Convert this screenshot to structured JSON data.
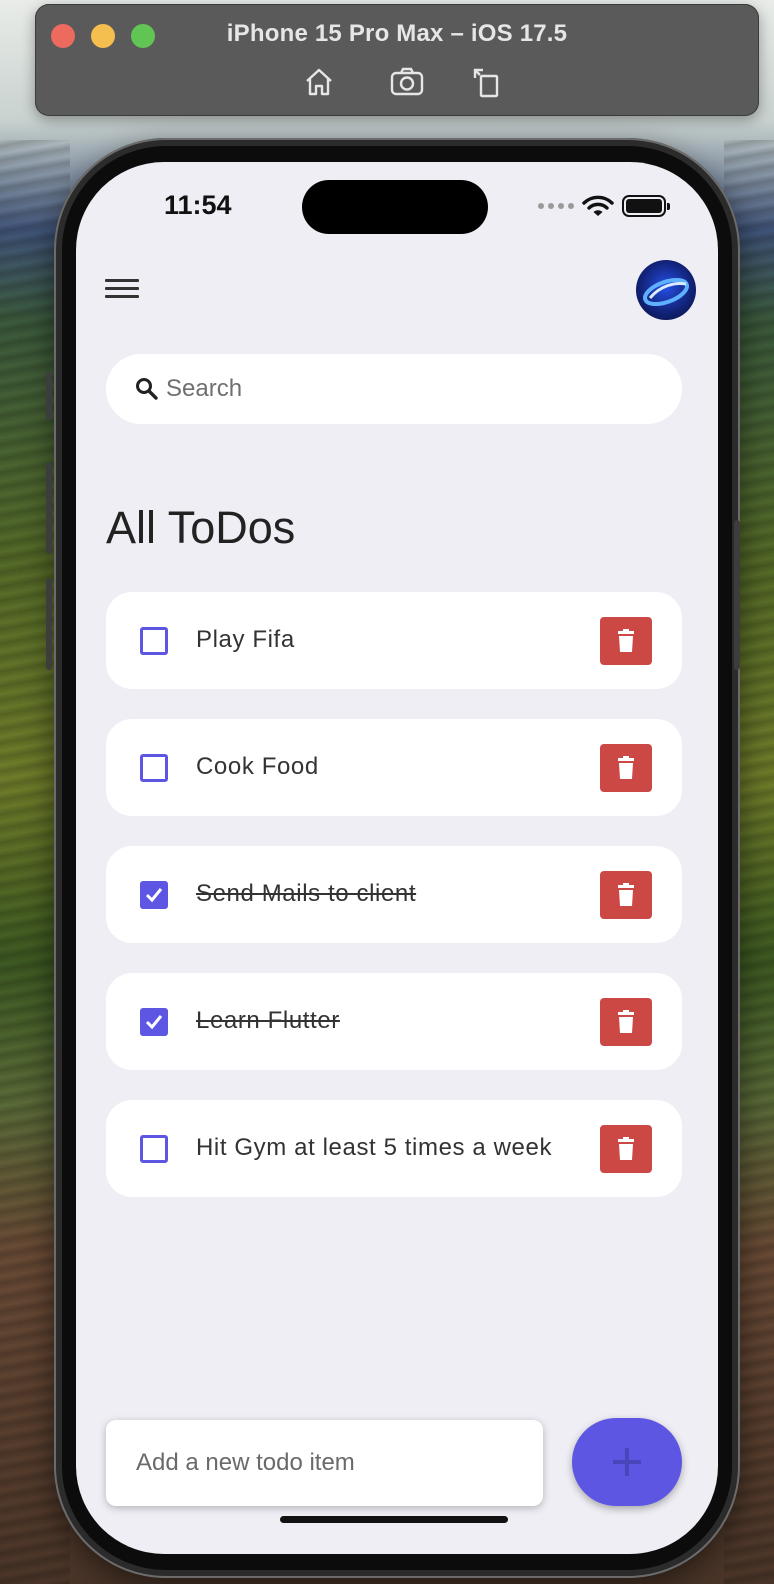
{
  "simulator": {
    "title": "iPhone 15 Pro Max – iOS 17.5",
    "toolbar_icons": [
      "home-icon",
      "screenshot-icon",
      "rotate-icon"
    ]
  },
  "status_bar": {
    "time": "11:54",
    "icons": [
      "cellular-signal-icon",
      "wifi-icon",
      "battery-icon"
    ]
  },
  "header": {
    "menu_icon": "hamburger-menu-icon",
    "avatar_icon": "profile-avatar"
  },
  "search": {
    "placeholder": "Search",
    "value": ""
  },
  "section_title": "All ToDos",
  "todos": [
    {
      "text": "Play Fifa",
      "done": false
    },
    {
      "text": "Cook Food",
      "done": false
    },
    {
      "text": "Send Mails to client",
      "done": true
    },
    {
      "text": "Learn Flutter",
      "done": true
    },
    {
      "text": "Hit Gym at least 5 times a week",
      "done": false
    }
  ],
  "add_todo": {
    "placeholder": "Add a new todo item",
    "value": "",
    "button_icon": "plus-icon"
  },
  "colors": {
    "accent": "#5d56e3",
    "delete": "#cc4845",
    "background": "#eeeef4"
  }
}
